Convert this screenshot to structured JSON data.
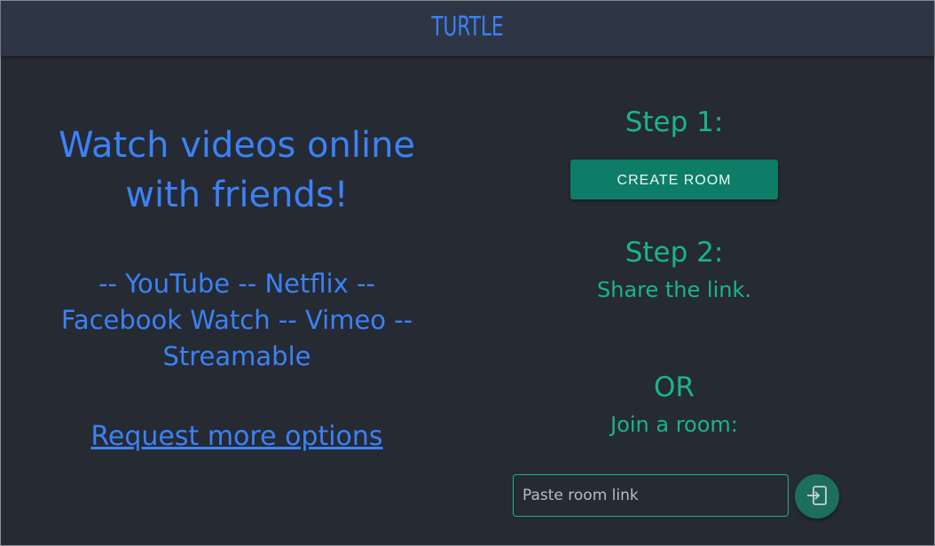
{
  "header": {
    "brand": "TURTLE"
  },
  "hero": {
    "headline_line1": "Watch videos online",
    "headline_line2": "with friends!",
    "services_line1": "-- YouTube -- Netflix --",
    "services_line2": "Facebook Watch -- Vimeo --",
    "services_line3": "Streamable",
    "request_link": "Request more options"
  },
  "steps": {
    "step1_title": "Step 1:",
    "create_room_label": "CREATE ROOM",
    "step2_title": "Step 2:",
    "step2_text": "Share the link.",
    "or_text": "OR",
    "join_text": "Join a room:"
  },
  "join": {
    "placeholder": "Paste room link",
    "button_icon": "enter-icon"
  },
  "colors": {
    "background": "#262a33",
    "topbar": "#2e3646",
    "blue_accent": "#3b82f6",
    "green_accent": "#19b48e",
    "button_green": "#0e7d68"
  }
}
